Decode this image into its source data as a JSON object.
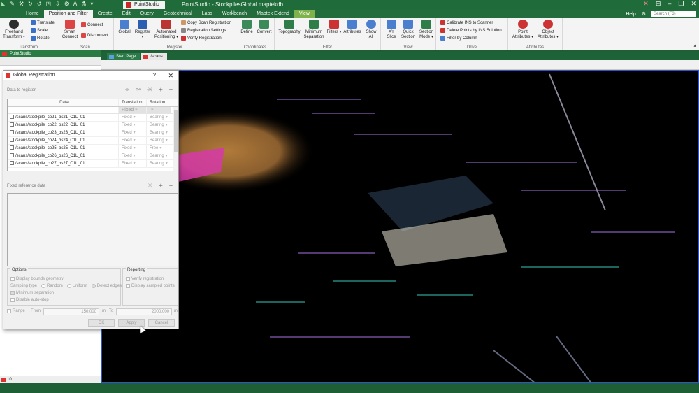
{
  "titlebar": {
    "app_tab": "PointStudio",
    "window_title": "PointStudio - StockpilesGlobal.maptekdb"
  },
  "menubar": {
    "items": [
      "Home",
      "Position and Filter",
      "Create",
      "Edit",
      "Query",
      "Geotechnical",
      "Labs",
      "Workbench",
      "Maptek Extend",
      "View"
    ],
    "help": "Help",
    "search_placeholder": "Search (F3)"
  },
  "ribbon": {
    "transform": {
      "freehand": "Freehand Transform ▾",
      "translate": "Translate",
      "scale": "Scale",
      "rotate": "Rotate",
      "label": "Transform"
    },
    "scan": {
      "smart_connect": "Smart Connect",
      "connect": "Connect",
      "disconnect": "Disconnect",
      "label": "Scan"
    },
    "register": {
      "global": "Global",
      "register": "Register ▾",
      "automated": "Automated Positioning ▾",
      "copy": "Copy Scan Registration",
      "settings": "Registration Settings",
      "verify": "Verify Registration",
      "label": "Register"
    },
    "coordinates": {
      "define": "Define",
      "convert": "Convert",
      "label": "Coordinates"
    },
    "filter": {
      "topography": "Topography",
      "min_sep": "Minimum Separation",
      "filters": "Filters ▾",
      "attributes": "Attributes",
      "show_all": "Show All",
      "label": "Filter"
    },
    "view": {
      "xy_slice": "XY Slice",
      "quick_section": "Quick Section",
      "section_mode": "Section Mode ▾",
      "label": "View"
    },
    "drive": {
      "calibrate": "Calibrate INS to Scanner",
      "delete": "Delete Points by INS Solution",
      "filter_col": "Filter by Column",
      "label": "Drive"
    },
    "attributes": {
      "point": "Point Attributes ▾",
      "object": "Object Attributes ▾",
      "label": "Attributes"
    }
  },
  "left_panel": {
    "title": "PointStudio",
    "status": "10"
  },
  "view_tabs": [
    "Start Page",
    "/scans"
  ],
  "dialog": {
    "title": "Global Registration",
    "help": "?",
    "close": "✕",
    "data_to_register": "Data to register",
    "col_data": "Data",
    "col_translation": "Translation",
    "col_rotation": "Rotation",
    "fixed_header_value": "Fixed",
    "rows": [
      {
        "name": "/scans/stockpile_cp21_bs21_C1L_01",
        "translation": "Fixed",
        "rotation": "Bearing"
      },
      {
        "name": "/scans/stockpile_cp22_bs22_C1L_01",
        "translation": "Fixed",
        "rotation": "Bearing"
      },
      {
        "name": "/scans/stockpile_cp23_bs23_C1L_01",
        "translation": "Fixed",
        "rotation": "Bearing"
      },
      {
        "name": "/scans/stockpile_cp24_bs24_C1L_01",
        "translation": "Fixed",
        "rotation": "Bearing"
      },
      {
        "name": "/scans/stockpile_cp25_bs25_C1L_01",
        "translation": "Fixed",
        "rotation": "Free"
      },
      {
        "name": "/scans/stockpile_cp26_bs26_C1L_01",
        "translation": "Fixed",
        "rotation": "Bearing"
      },
      {
        "name": "/scans/stockpile_cp27_bs27_C1L_01",
        "translation": "Fixed",
        "rotation": "Bearing"
      }
    ],
    "fixed_reference": "Fixed reference data",
    "options": {
      "title": "Options",
      "display_bounds": "Display bounds geometry",
      "sampling_type": "Sampling type",
      "random": "Random",
      "uniform": "Uniform",
      "detect_edges": "Detect edges",
      "minimum_separation": "Minimum separation",
      "disable_auto_stop": "Disable auto-stop"
    },
    "reporting": {
      "title": "Reporting",
      "verify": "Verify registration",
      "display_sampled": "Display sampled points"
    },
    "range": {
      "label": "Range",
      "from": "From",
      "from_value": "150.000",
      "unit1": "m",
      "to": "To",
      "to_value": "2000.000",
      "unit2": "m"
    },
    "buttons": {
      "ok": "OK",
      "apply": "Apply",
      "cancel": "Cancel"
    }
  },
  "colors": {
    "title_green": "#1f6b3a",
    "accent_red": "#c82828",
    "viewport_border": "#2f56c8"
  }
}
